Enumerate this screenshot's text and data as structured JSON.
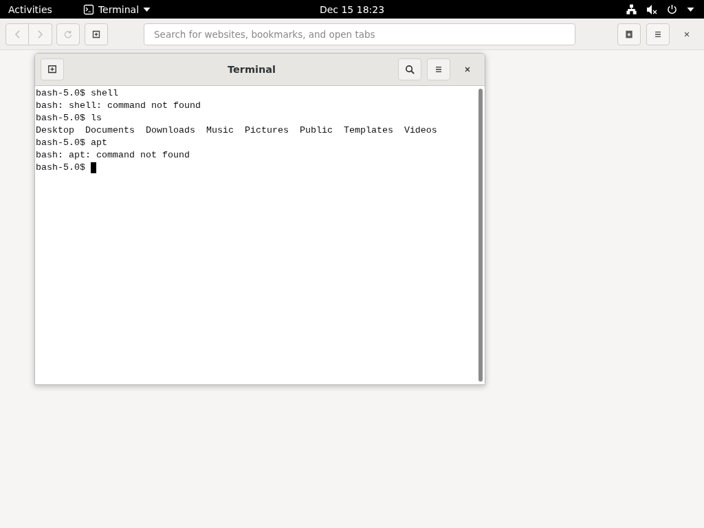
{
  "top_bar": {
    "activities": "Activities",
    "app_menu": "Terminal",
    "clock": "Dec 15  18:23"
  },
  "browser": {
    "nav_buttons": [
      {
        "kind": "back",
        "disabled": true
      },
      {
        "kind": "forward",
        "disabled": true
      },
      {
        "kind": "reload",
        "disabled": true
      },
      {
        "kind": "new-tab",
        "disabled": false
      }
    ],
    "search": {
      "placeholder": "Search for websites, bookmarks, and open tabs"
    }
  },
  "terminal": {
    "title": "Terminal",
    "lines": [
      "bash-5.0$ shell",
      "bash: shell: command not found",
      "bash-5.0$ ls",
      "Desktop  Documents  Downloads  Music  Pictures  Public  Templates  Videos",
      "bash-5.0$ apt",
      "bash: apt: command not found",
      "bash-5.0$ "
    ],
    "cursor": true
  }
}
